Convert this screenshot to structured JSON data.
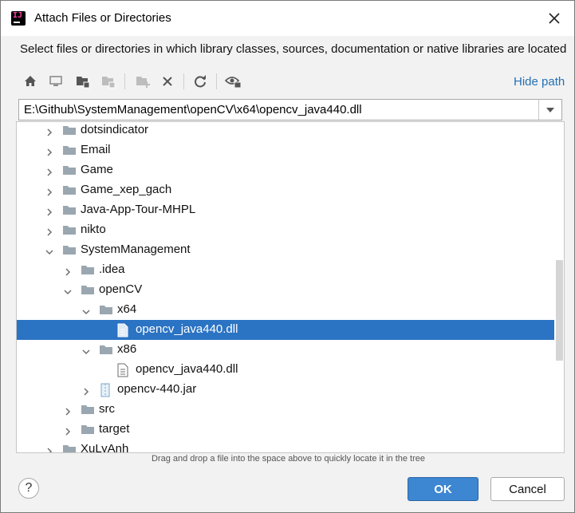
{
  "window": {
    "title": "Attach Files or Directories"
  },
  "description": "Select files or directories in which library classes, sources, documentation or native libraries are located",
  "toolbar": {
    "buttons": [
      {
        "icon": "home-icon"
      },
      {
        "icon": "desktop-icon"
      },
      {
        "icon": "project-folder-icon"
      },
      {
        "icon": "module-folder-icon"
      },
      {
        "icon": "new-folder-icon"
      },
      {
        "icon": "delete-icon"
      },
      {
        "icon": "refresh-icon"
      },
      {
        "icon": "show-hidden-icon"
      }
    ],
    "hide_path_label": "Hide path"
  },
  "path": {
    "value": "E:\\Github\\SystemManagement\\openCV\\x64\\opencv_java440.dll"
  },
  "tree": {
    "rows": [
      {
        "label": "dotsindicator",
        "type": "folder",
        "expanded": false
      },
      {
        "label": "Email",
        "type": "folder",
        "expanded": false
      },
      {
        "label": "Game",
        "type": "folder",
        "expanded": false
      },
      {
        "label": "Game_xep_gach",
        "type": "folder",
        "expanded": false
      },
      {
        "label": "Java-App-Tour-MHPL",
        "type": "folder",
        "expanded": false
      },
      {
        "label": "nikto",
        "type": "folder",
        "expanded": false
      },
      {
        "label": "SystemManagement",
        "type": "folder",
        "expanded": true
      },
      {
        "label": ".idea",
        "type": "folder",
        "expanded": false
      },
      {
        "label": "openCV",
        "type": "folder",
        "expanded": true
      },
      {
        "label": "x64",
        "type": "folder",
        "expanded": true
      },
      {
        "label": "opencv_java440.dll",
        "type": "file",
        "selected": true
      },
      {
        "label": "x86",
        "type": "folder",
        "expanded": true
      },
      {
        "label": "opencv_java440.dll",
        "type": "file"
      },
      {
        "label": "opencv-440.jar",
        "type": "jar",
        "expanded": false
      },
      {
        "label": "src",
        "type": "folder",
        "expanded": false
      },
      {
        "label": "target",
        "type": "folder",
        "expanded": false
      },
      {
        "label": "XuLyAnh",
        "type": "folder",
        "expanded": false
      }
    ]
  },
  "hint": "Drag and drop a file into the space above to quickly locate it in the tree",
  "buttons": {
    "help": "?",
    "ok": "OK",
    "cancel": "Cancel"
  },
  "colors": {
    "selection": "#2b73c3",
    "link": "#2470b3",
    "ok_button": "#3d86d1",
    "folder": "#9aa7b0"
  }
}
